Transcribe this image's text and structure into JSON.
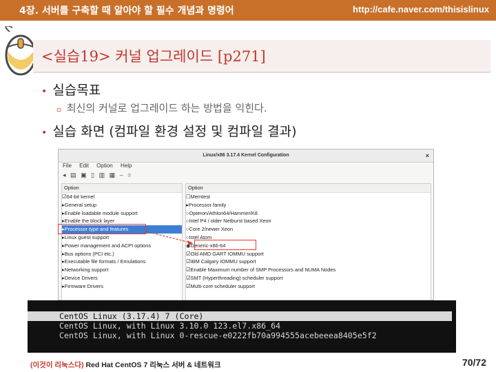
{
  "header": {
    "chapter": "4장. 서버를 구축할 때 알아야 할 필수 개념과 명령어",
    "url": "http://cafe.naver.com/thisislinux"
  },
  "title": "<실습19> 커널 업그레이드 [p271]",
  "bullets": {
    "goal_heading": "실습목표",
    "goal_text": "최신의 커널로 업그레이드 하는 방법을 익힌다.",
    "screen_heading": "실습 화면 (컴파일 환경 설정 및 컴파일 결과)"
  },
  "window": {
    "title": "Linux/x86 3.17.4 Kernel Configuration",
    "menu": [
      "File",
      "Edit",
      "Option",
      "Help"
    ],
    "left_header": "Option",
    "left_items": [
      "☑64-bit kernel",
      "▸General setup",
      "▸Enable loadable module support",
      "▸Enable the block layer",
      "▸Processor type and features",
      "   ▸Linux guest support",
      "▸Power management and ACPI options",
      "▸Bus options (PCI etc.)",
      "▸Executable file formats / Emulations",
      "▸Networking support",
      "▸Device Drivers",
      "▸Firmware Drivers"
    ],
    "left_selected_index": 4,
    "right_header": "Option",
    "right_items": [
      "☐Memtest",
      "▸Processor family",
      "  ○Opteron/Athlon64/Hammer/K8",
      "  ○Intel P4 / older Netburst based Xeon",
      "  ○Core 2/newer Xeon",
      "  ○Intel Atom",
      "  ◉Generic-x86-64",
      "☑Old AMD GART IOMMU support",
      "☑IBM Calgary IOMMU support",
      "☑Enable Maximum number of SMP Processors and NUMA Nodes",
      "☑SMT (Hyperthreading) scheduler support",
      "☑Multi-core scheduler support"
    ]
  },
  "terminal": {
    "lines": [
      "CentOS Linux (3.17.4) 7 (Core)",
      "CentOS Linux, with Linux 3.10.0 123.el7.x86_64",
      "CentOS Linux, with Linux 0-rescue-e0222fb70a994555acebeeea8405e5f2"
    ],
    "selected_index": 0
  },
  "footer": {
    "book_prefix": "(이것이 리눅스다)",
    "book_rest": " Red Hat CentOS 7 리눅스 서버 & 네트워크",
    "page": "70/72"
  },
  "colors": {
    "header_bar": "#c8702a",
    "title_text": "#c0392b",
    "highlight_box": "#e03c2c",
    "selection": "#3d7ed5"
  }
}
